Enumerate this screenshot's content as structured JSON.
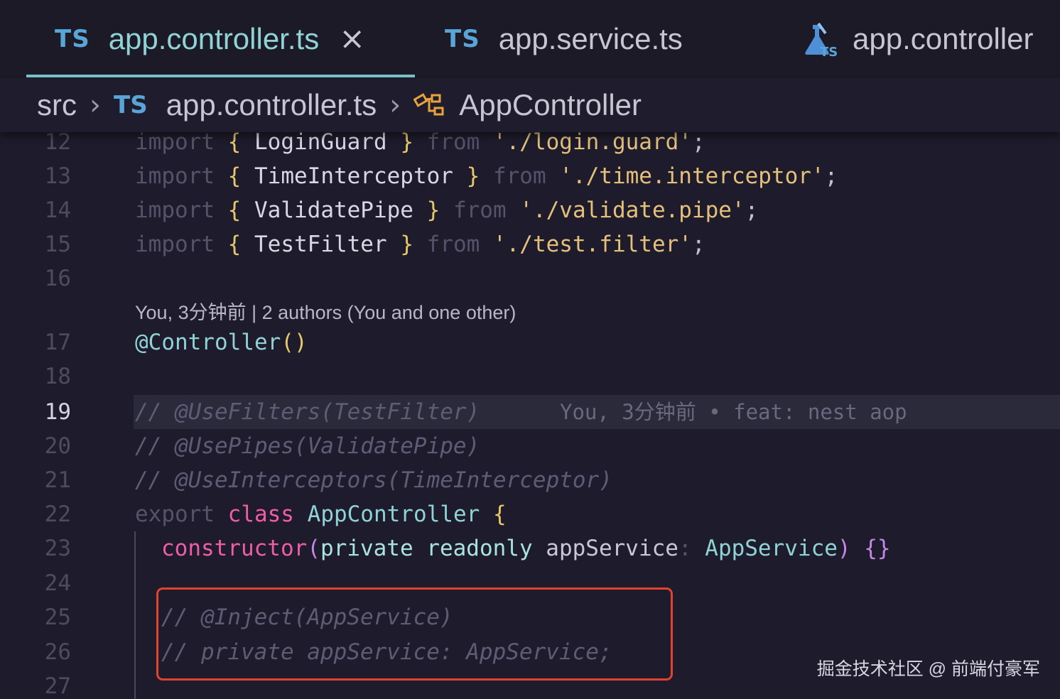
{
  "tabs": [
    {
      "badge": "TS",
      "label": "app.controller.ts",
      "active": true,
      "close": "×"
    },
    {
      "badge": "TS",
      "label": "app.service.ts",
      "active": false
    },
    {
      "label": "app.controller",
      "icon": "test-flask-ts-icon"
    }
  ],
  "breadcrumb": {
    "folder": "src",
    "file_badge": "TS",
    "file": "app.controller.ts",
    "symbol": "AppController"
  },
  "editor": {
    "line_numbers": [
      "12",
      "13",
      "14",
      "15",
      "16",
      "17",
      "18",
      "19",
      "20",
      "21",
      "22",
      "23",
      "24",
      "25",
      "26",
      "27"
    ],
    "lines": {
      "l12": {
        "kw": "import",
        "open": "{",
        "name": "LoginGuard",
        "close": "}",
        "from": "from",
        "path": "'./login.guard'",
        "semi": ";"
      },
      "l13": {
        "kw": "import",
        "open": "{",
        "name": "TimeInterceptor",
        "close": "}",
        "from": "from",
        "path": "'./time.interceptor'",
        "semi": ";"
      },
      "l14": {
        "kw": "import",
        "open": "{",
        "name": "ValidatePipe",
        "close": "}",
        "from": "from",
        "path": "'./validate.pipe'",
        "semi": ";"
      },
      "l15": {
        "kw": "import",
        "open": "{",
        "name": "TestFilter",
        "close": "}",
        "from": "from",
        "path": "'./test.filter'",
        "semi": ";"
      },
      "codelens": "You, 3分钟前 | 2 authors (You and one other)",
      "l17": {
        "at": "@Controller",
        "parens": "()"
      },
      "l19": {
        "text": "// @UseFilters(TestFilter)",
        "blame": "You, 3分钟前 • feat: nest aop"
      },
      "l20": {
        "text": "// @UsePipes(ValidatePipe)"
      },
      "l21": {
        "text": "// @UseInterceptors(TimeInterceptor)"
      },
      "l22": {
        "kw": "export",
        "cls_kw": "class",
        "name": "AppController",
        "brace": "{"
      },
      "l23": {
        "ctor": "constructor",
        "open": "(",
        "priv": "private",
        "ro": "readonly",
        "param": "appService",
        "colon": ":",
        "type": "AppService",
        "close": ")",
        "body": "{}"
      },
      "l25": {
        "text": "// @Inject(AppService)"
      },
      "l26": {
        "text": "// private appService: AppService;"
      }
    },
    "current_line": "19"
  },
  "watermark": "掘金技术社区 @ 前端付豪军"
}
